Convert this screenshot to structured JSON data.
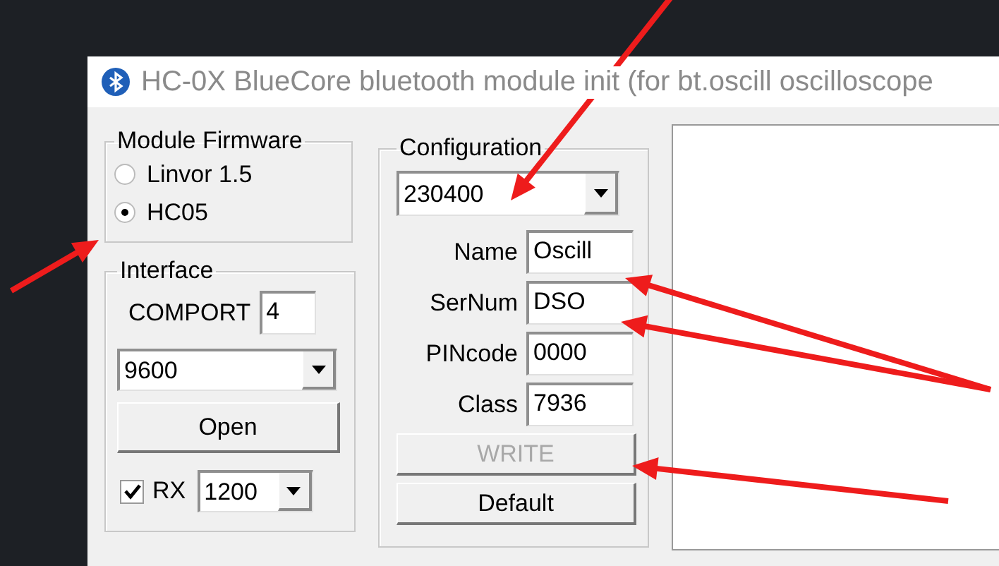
{
  "window": {
    "title": "HC-0X BlueCore bluetooth module init (for bt.oscill oscilloscope"
  },
  "module_firmware": {
    "title": "Module Firmware",
    "options": [
      {
        "label": "Linvor 1.5",
        "selected": false
      },
      {
        "label": "HC05",
        "selected": true
      }
    ]
  },
  "interface": {
    "title": "Interface",
    "comport_label": "COMPORT",
    "comport": "4",
    "baud": "9600",
    "open_button": "Open",
    "rx": {
      "label": "RX",
      "checked": true,
      "rate": "1200"
    }
  },
  "configuration": {
    "title": "Configuration",
    "baud": "230400",
    "fields": [
      {
        "label": "Name",
        "value": "Oscill"
      },
      {
        "label": "SerNum",
        "value": "DSO"
      },
      {
        "label": "PINcode",
        "value": "0000"
      },
      {
        "label": "Class",
        "value": "7936"
      }
    ],
    "write_button": {
      "label": "WRITE",
      "disabled": true
    },
    "default_button": "Default"
  }
}
